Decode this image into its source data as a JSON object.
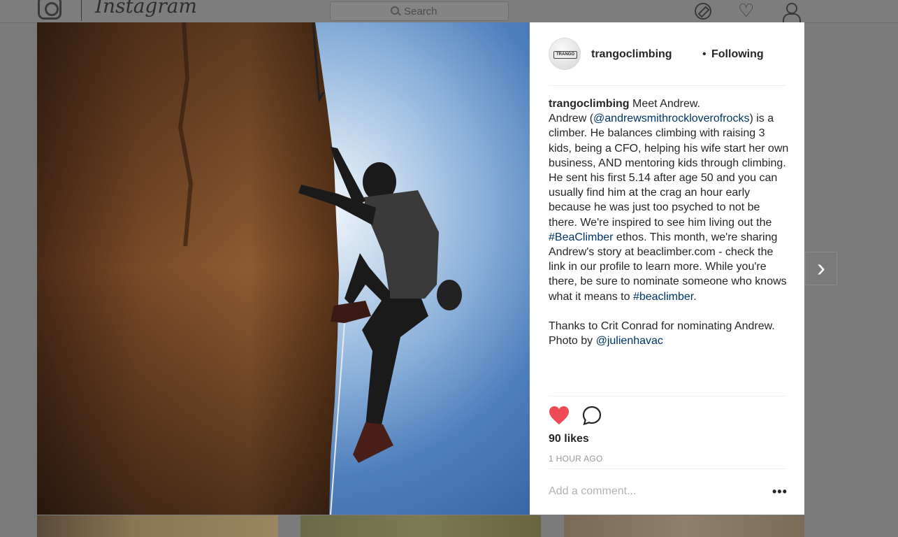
{
  "background": {
    "app_name": "Instagram",
    "search_placeholder": "Search"
  },
  "post": {
    "username": "trangoclimbing",
    "separator": "•",
    "follow_status": "Following",
    "avatar_text": "TRANGO",
    "caption": {
      "intro": "Meet Andrew.",
      "p1_a": "Andrew (",
      "mention_1": "@andrewsmithrockloverofrocks",
      "p1_b": ") is a climber. He balances climbing with raising 3 kids, being a CFO, helping his wife start her own business, AND mentoring kids through climbing. He sent his first 5.14 after age 50 and you can usually find him at the crag an hour early because he was just too psyched to not be there. We're inspired to see him living out the ",
      "hashtag_1": "#BeaClimber",
      "p1_c": " ethos. This month, we're sharing Andrew's story at beaclimber.com - check the link in our profile to learn more. While you're there, be sure to nominate someone who knows what it means to ",
      "hashtag_2": "#beaclimber",
      "p1_d": ".",
      "p2_a": "Thanks to Crit Conrad for nominating Andrew. Photo by ",
      "mention_2": "@julienhavac"
    },
    "likes": "90 likes",
    "time": "1 HOUR AGO",
    "comment_placeholder": "Add a comment...",
    "more_label": "•••",
    "liked": true
  },
  "icons": {
    "like": "heart-icon",
    "comment": "comment-icon",
    "more": "more-options-icon",
    "next": "chevron-right-icon",
    "compass": "compass-icon",
    "heart_nav": "heart-outline-icon",
    "profile": "profile-icon"
  },
  "colors": {
    "like_red": "#ed4956",
    "link_blue": "#003569",
    "text": "#262626",
    "muted": "#999999"
  },
  "nav": {
    "next_label": "›"
  }
}
